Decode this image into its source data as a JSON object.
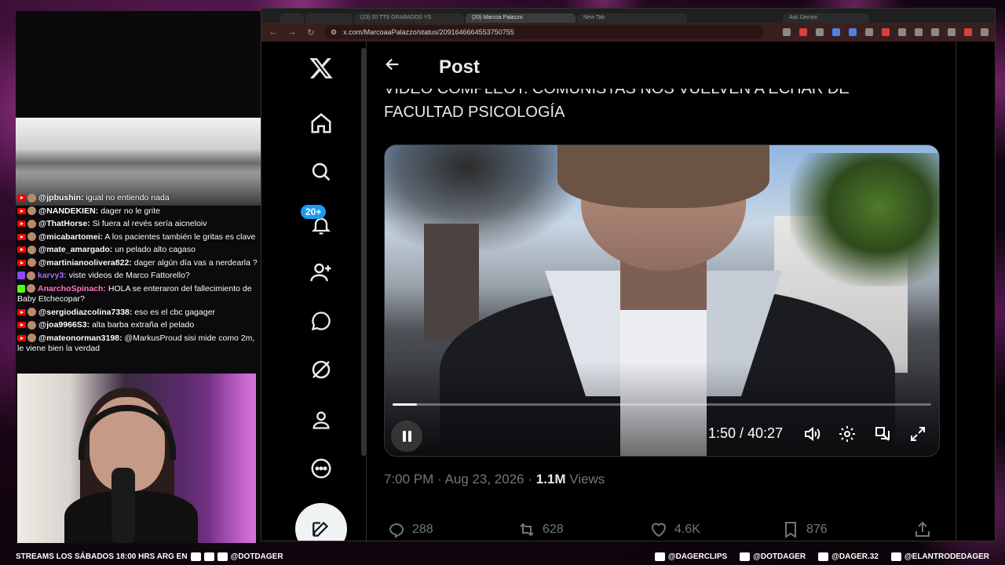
{
  "browser": {
    "tabs": [
      {
        "label": ""
      },
      {
        "label": ""
      },
      {
        "label": "(23) 20 TTS GRABADOS YS"
      },
      {
        "label": "(20) Marcoa Palazzo"
      },
      {
        "label": "New Tab"
      },
      {
        "label": "Ask Gemini"
      }
    ],
    "url": "x.com/MarcoaaPalazzo/status/2091646664553750755"
  },
  "x": {
    "notification_count": "20+",
    "header_title": "Post",
    "post_text_line1": "VIDEO COMPLEOT: COMUNISTAS NOS VUELVEN A ECHAR DE",
    "post_text_line2": "FACULTAD PSICOLOGÍA",
    "video": {
      "time": "1:50 / 40:27",
      "progress": 0.045
    },
    "meta": {
      "datetime": "7:00 PM · Aug 23, 2026 · ",
      "views_count": "1.1M",
      "views_label": " Views"
    },
    "actions": {
      "replies": "288",
      "reposts": "628",
      "likes": "4.6K",
      "bookmarks": "876"
    }
  },
  "chat": [
    {
      "platform": "yt",
      "user": "@jpbushin:",
      "text": " igual no entiendo nada",
      "color": "#ffffff"
    },
    {
      "platform": "yt",
      "user": "@NANDEKIEN:",
      "text": " dager no le grite",
      "color": "#ffffff"
    },
    {
      "platform": "yt",
      "user": "@ThatHorse:",
      "text": " Si fuera al revés sería aicneloiv",
      "color": "#ffffff"
    },
    {
      "platform": "yt",
      "user": "@micabartomei:",
      "text": " A los pacientes también le gritas es clave",
      "color": "#ffffff"
    },
    {
      "platform": "yt",
      "user": "@mate_amargado:",
      "text": " un pelado alto cagaso",
      "color": "#ffffff"
    },
    {
      "platform": "yt",
      "user": "@martinianoolivera822:",
      "text": " dager algún día vas a nerdearla ?",
      "color": "#ffffff"
    },
    {
      "platform": "tw",
      "user": "karvy3:",
      "text": " viste videos de Marco Fattorello?",
      "color": "#a970ff"
    },
    {
      "platform": "kick",
      "user": "AnarchoSpinach:",
      "text": " HOLA se enteraron del fallecimiento de Baby Etchecopar?",
      "color": "#ff7ab8"
    },
    {
      "platform": "yt",
      "user": "@sergiodiazcolina7338:",
      "text": " eso es el cbc gagager",
      "color": "#ffffff"
    },
    {
      "platform": "yt",
      "user": "@joa9966S3:",
      "text": " alta barba extraña el pelado",
      "color": "#ffffff"
    },
    {
      "platform": "yt",
      "user": "@mateonorman3198:",
      "text": " @MarkusProud sisi mide como 2m, le viene bien la verdad",
      "color": "#ffffff"
    }
  ],
  "bottom_bar": {
    "streams_text": "STREAMS LOS SÁBADOS 18:00 HRS ARG EN",
    "left_handle": "@DOTDAGER",
    "right": [
      "@DAGERCLIPS",
      "@DOTDAGER",
      "@DAGER.32",
      "@ELANTRODEDAGER"
    ]
  }
}
